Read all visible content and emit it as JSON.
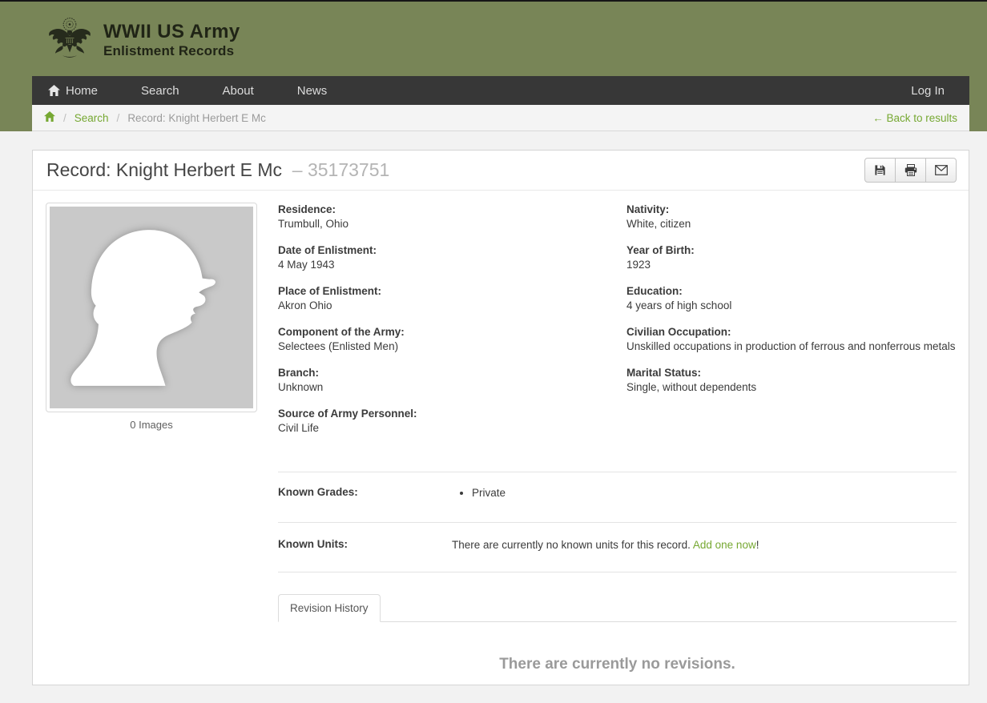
{
  "brand": {
    "title_line1": "WWII US Army",
    "title_line2": "Enlistment Records",
    "logo_icon": "us-army-eagle-seal"
  },
  "nav": {
    "items": [
      {
        "label": "Home",
        "icon": "home-icon"
      },
      {
        "label": "Search"
      },
      {
        "label": "About"
      },
      {
        "label": "News"
      }
    ],
    "login_label": "Log In"
  },
  "breadcrumb": {
    "home_icon": "home-icon",
    "sep": "/",
    "search_label": "Search",
    "current": "Record: Knight Herbert E Mc",
    "back_label": "← Back to results"
  },
  "record": {
    "title": "Record: Knight Herbert E Mc",
    "serial": "– 35173751",
    "toolbar_icons": [
      "floppy-disk-save-icon",
      "printer-icon",
      "envelope-email-icon"
    ],
    "images_caption": "0 Images",
    "fields_left": [
      {
        "label": "Residence:",
        "value": "Trumbull, Ohio"
      },
      {
        "label": "Date of Enlistment:",
        "value": "4 May 1943"
      },
      {
        "label": "Place of Enlistment:",
        "value": "Akron Ohio"
      },
      {
        "label": "Component of the Army:",
        "value": "Selectees (Enlisted Men)"
      },
      {
        "label": "Branch:",
        "value": "Unknown"
      },
      {
        "label": "Source of Army Personnel:",
        "value": "Civil Life"
      }
    ],
    "fields_right": [
      {
        "label": "Nativity:",
        "value": "White, citizen"
      },
      {
        "label": "Year of Birth:",
        "value": "1923"
      },
      {
        "label": "Education:",
        "value": "4 years of high school"
      },
      {
        "label": "Civilian Occupation:",
        "value": "Unskilled occupations in production of ferrous and nonferrous metals"
      },
      {
        "label": "Marital Status:",
        "value": "Single, without dependents"
      }
    ],
    "known_grades_label": "Known Grades:",
    "grades": [
      "Private"
    ],
    "known_units_label": "Known Units:",
    "units_empty_text": "There are currently no known units for this record. ",
    "units_add_link": "Add one now",
    "units_add_suffix": "!",
    "tab_label": "Revision History",
    "revisions_empty": "There are currently no revisions."
  },
  "colors": {
    "masthead_olive": "#788557",
    "navbar_dark": "#373737",
    "link_green": "#76a832",
    "muted_gray": "#9b9b9b",
    "thumb_gray": "#c9c9c9"
  }
}
